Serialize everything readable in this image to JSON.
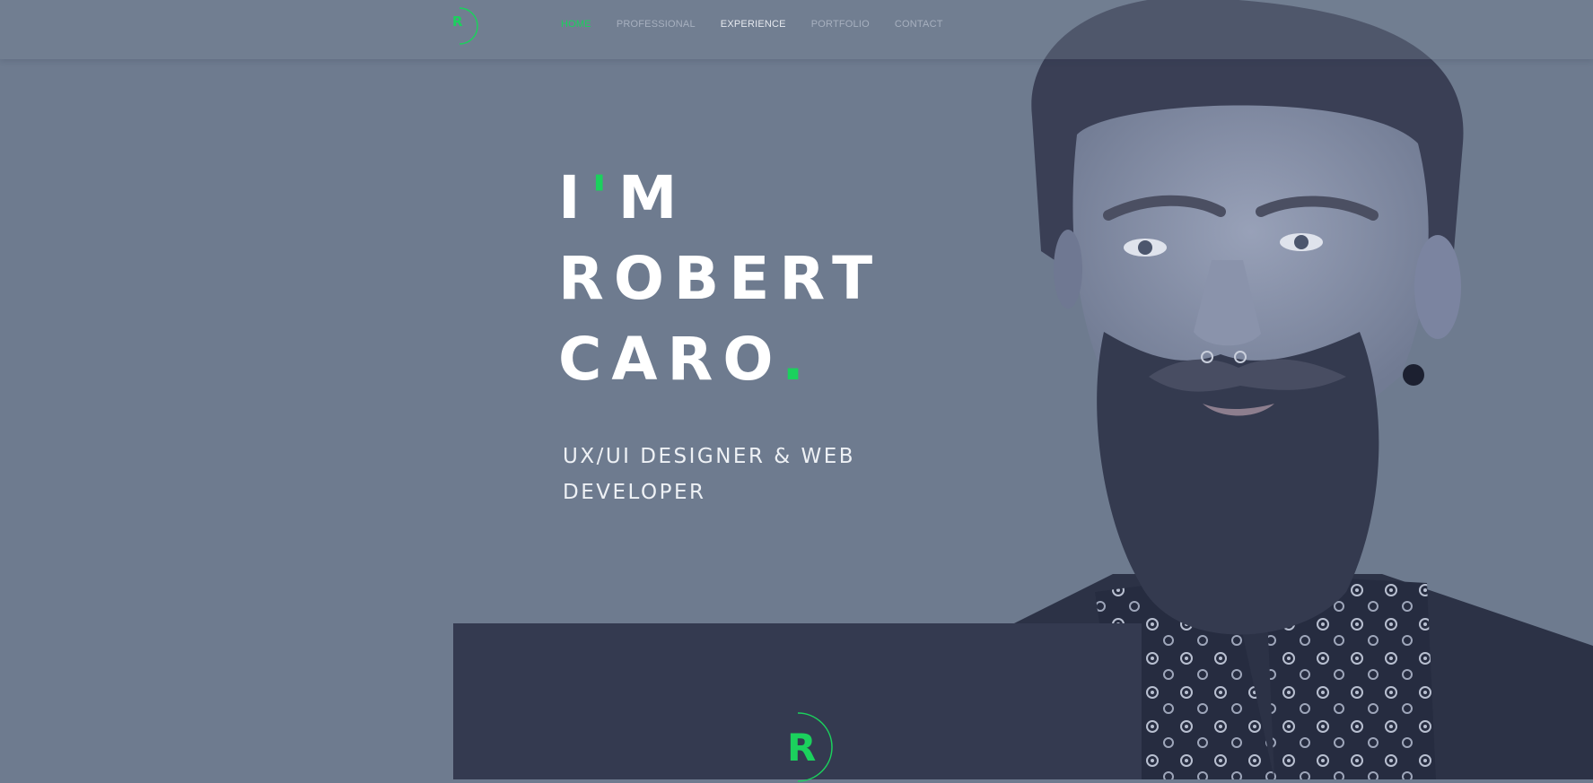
{
  "brand": {
    "logo_letter": "R",
    "accent_color": "#1bd15d"
  },
  "nav": {
    "items": [
      {
        "label": "HOME",
        "state": "active"
      },
      {
        "label": "PROFESSIONAL",
        "state": "normal"
      },
      {
        "label": "EXPERIENCE",
        "state": "highlight"
      },
      {
        "label": "PORTFOLIO",
        "state": "normal"
      },
      {
        "label": "CONTACT",
        "state": "normal"
      }
    ]
  },
  "hero": {
    "line1_a": "I",
    "line1_apos": "'",
    "line1_b": "M",
    "line2": "ROBERT",
    "line3": "CARO",
    "line3_dot": ".",
    "subtitle": "UX/UI DESIGNER & WEB DEVELOPER"
  },
  "card": {
    "logo_letter": "R"
  },
  "colors": {
    "background": "#6e7b8f",
    "card": "#343a50",
    "accent": "#1bd15d",
    "text": "#ffffff"
  },
  "images": {
    "portrait": "bearded-man-portrait"
  }
}
